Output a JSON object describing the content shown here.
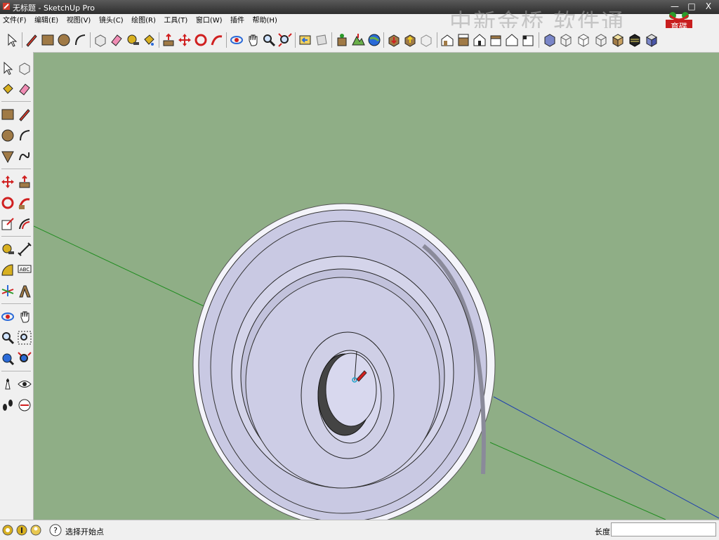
{
  "window": {
    "title": "无标题 - SketchUp Pro",
    "watermark": "中新金桥 软件通",
    "logo_text": "育碟软件",
    "buttons": {
      "minimize": "—",
      "restore": "□",
      "close": "X"
    }
  },
  "menu": {
    "items": [
      {
        "label": "文件(F)"
      },
      {
        "label": "编辑(E)"
      },
      {
        "label": "视图(V)"
      },
      {
        "label": "镜头(C)"
      },
      {
        "label": "绘图(R)"
      },
      {
        "label": "工具(T)"
      },
      {
        "label": "窗口(W)"
      },
      {
        "label": "插件"
      },
      {
        "label": "帮助(H)"
      }
    ]
  },
  "toolbar": {
    "tools": [
      "select",
      "pencil",
      "rectangle",
      "circle",
      "arc",
      "make-component",
      "eraser",
      "tape-measure",
      "paint-bucket",
      "push-pull",
      "move",
      "rotate",
      "follow-me",
      "orbit",
      "pan",
      "zoom",
      "zoom-extents",
      "previous-view",
      "next-view",
      "add-location",
      "toggle-terrain",
      "google-earth",
      "get-models",
      "share-model",
      "share-component",
      "iso",
      "top",
      "front",
      "right",
      "back",
      "left",
      "xray",
      "wireframe",
      "hidden-line",
      "shaded",
      "shaded-textures",
      "monochrome"
    ]
  },
  "left_toolbar": {
    "tools": [
      "select",
      "component",
      "paint-bucket",
      "eraser",
      "rectangle",
      "line",
      "circle",
      "arc",
      "polygon",
      "freehand",
      "move",
      "push-pull",
      "rotate",
      "follow-me",
      "scale",
      "offset",
      "tape-measure",
      "dimension",
      "protractor",
      "text",
      "axes",
      "3d-text",
      "orbit",
      "pan",
      "zoom",
      "zoom-window",
      "previous",
      "zoom-extents",
      "position-camera",
      "look-around",
      "walk",
      "section-plane"
    ]
  },
  "status": {
    "hint": "选择开始点",
    "vcb_label": "长度",
    "vcb_value": ""
  },
  "colors": {
    "background": "#8fae86",
    "model_face": "#c9c9e3",
    "axis_green": "#1f8c1f",
    "axis_blue": "#1f3fae",
    "axis_red": "#c42020"
  }
}
